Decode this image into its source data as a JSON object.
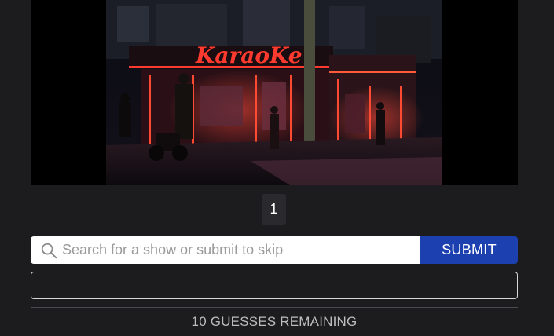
{
  "clip_frame": {
    "sign_text": "KaraoKe",
    "accent_color": "#ff3a2e"
  },
  "pagination": {
    "current_page": "1"
  },
  "search": {
    "placeholder": "Search for a show or submit to skip",
    "value": "",
    "submit_label": "SUBMIT",
    "submit_color": "#1d40b0"
  },
  "guesses": {
    "remaining_text": "10 GUESSES REMAINING"
  }
}
